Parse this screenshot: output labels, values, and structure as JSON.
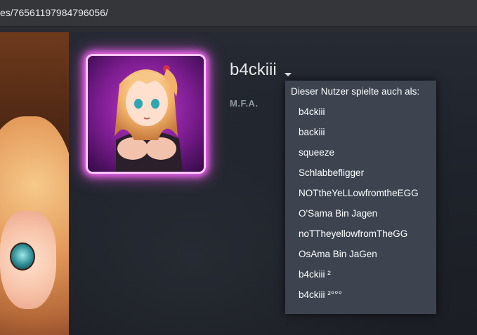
{
  "browser": {
    "url_fragment": "es/76561197984796056/"
  },
  "profile": {
    "username": "b4ckiii",
    "real_name": "M.F.A."
  },
  "aliases_dropdown": {
    "title": "Dieser Nutzer spielte auch als:",
    "items": [
      "b4ckiii",
      "backiii",
      "squeeze",
      "Schlabbefligger",
      "NOTtheYeLLowfromtheEGG",
      "O'Sama Bin Jagen",
      "noTTheyellowfromTheGG",
      "OsAma Bin JaGen",
      "b4ckiii ²",
      "b4ckiii ²°°°"
    ]
  },
  "colors": {
    "avatar_frame_glow": "#ff6bff",
    "dropdown_bg": "#3d4450",
    "page_bg": "#1e2027"
  }
}
